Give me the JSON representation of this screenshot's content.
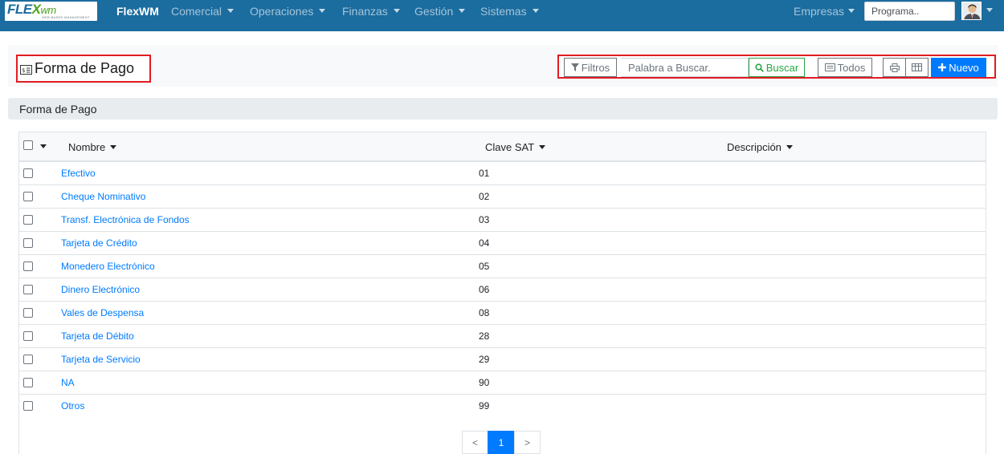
{
  "navbar": {
    "logo": {
      "text_main": "FLE",
      "text_x": "X",
      "text_wm": "wm",
      "subtitle": "WEB-BASED MANAGEMENT"
    },
    "brand": "FlexWM",
    "menus": [
      "Comercial",
      "Operaciones",
      "Finanzas",
      "Gestión",
      "Sistemas"
    ],
    "empresas_label": "Empresas",
    "program_search": {
      "placeholder": "Programa.."
    },
    "user_icon": "user-avatar-icon"
  },
  "page": {
    "title": "Forma de Pago",
    "title_icon": "card-icon"
  },
  "toolbar": {
    "filters_label": "Filtros",
    "search_placeholder": "Palabra a Buscar.",
    "search_button": "Buscar",
    "all_label": "Todos",
    "print_icon": "print-icon",
    "columns_icon": "table-columns-icon",
    "new_label": "Nuevo"
  },
  "section": {
    "title": "Forma de Pago"
  },
  "table": {
    "columns": [
      "Nombre",
      "Clave SAT",
      "Descripción"
    ],
    "rows": [
      {
        "name": "Efectivo",
        "code": "01",
        "desc": ""
      },
      {
        "name": "Cheque Nominativo",
        "code": "02",
        "desc": ""
      },
      {
        "name": "Transf. Electrónica de Fondos",
        "code": "03",
        "desc": ""
      },
      {
        "name": "Tarjeta de Crédito",
        "code": "04",
        "desc": ""
      },
      {
        "name": "Monedero Electrónico",
        "code": "05",
        "desc": ""
      },
      {
        "name": "Dinero Electrónico",
        "code": "06",
        "desc": ""
      },
      {
        "name": "Vales de Despensa",
        "code": "08",
        "desc": ""
      },
      {
        "name": "Tarjeta de Débito",
        "code": "28",
        "desc": ""
      },
      {
        "name": "Tarjeta de Servicio",
        "code": "29",
        "desc": ""
      },
      {
        "name": "NA",
        "code": "90",
        "desc": ""
      },
      {
        "name": "Otros",
        "code": "99",
        "desc": ""
      }
    ]
  },
  "pagination": {
    "prev": "<",
    "current": "1",
    "next": ">"
  },
  "colors": {
    "navbar": "#1b6c9f",
    "link": "#007bff",
    "success": "#28a745",
    "primary": "#007bff",
    "highlight_border": "#e21b23"
  }
}
